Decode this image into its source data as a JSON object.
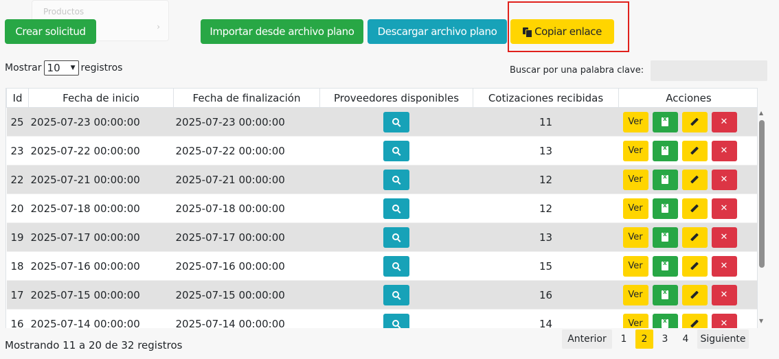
{
  "background_menu": {
    "item1": "Productos",
    "item2": "",
    "chevron": "›"
  },
  "toolbar": {
    "crear": "Crear solicitud",
    "importar": "Importar desde archivo plano",
    "descargar": "Descargar archivo plano",
    "copiar": "Copiar enlace",
    "copiar_icon": "copy-icon"
  },
  "colors": {
    "green": "#28a745",
    "teal": "#17a2b8",
    "yellow": "#ffd500",
    "red": "#dc3545",
    "highlight": "#e0201b"
  },
  "controls": {
    "mostrar": "Mostrar",
    "page_size": "10",
    "registros": "registros",
    "buscar_label": "Buscar por una palabra clave:",
    "buscar_value": ""
  },
  "table": {
    "headers": [
      "Id",
      "Fecha de inicio",
      "Fecha de finalización",
      "Proveedores disponibles",
      "Cotizaciones recibidas",
      "Acciones"
    ],
    "ver_label": "Ver",
    "rows": [
      {
        "id": "25",
        "inicio": "2025-07-23 00:00:00",
        "fin": "2025-07-23 00:00:00",
        "cotizaciones": "11"
      },
      {
        "id": "23",
        "inicio": "2025-07-22 00:00:00",
        "fin": "2025-07-22 00:00:00",
        "cotizaciones": "13"
      },
      {
        "id": "22",
        "inicio": "2025-07-21 00:00:00",
        "fin": "2025-07-21 00:00:00",
        "cotizaciones": "12"
      },
      {
        "id": "20",
        "inicio": "2025-07-18 00:00:00",
        "fin": "2025-07-18 00:00:00",
        "cotizaciones": "12"
      },
      {
        "id": "19",
        "inicio": "2025-07-17 00:00:00",
        "fin": "2025-07-17 00:00:00",
        "cotizaciones": "13"
      },
      {
        "id": "18",
        "inicio": "2025-07-16 00:00:00",
        "fin": "2025-07-16 00:00:00",
        "cotizaciones": "15"
      },
      {
        "id": "17",
        "inicio": "2025-07-15 00:00:00",
        "fin": "2025-07-15 00:00:00",
        "cotizaciones": "16"
      },
      {
        "id": "16",
        "inicio": "2025-07-14 00:00:00",
        "fin": "2025-07-14 00:00:00",
        "cotizaciones": "14"
      }
    ]
  },
  "footer": {
    "info": "Mostrando 11 a 20 de 32 registros",
    "anterior": "Anterior",
    "pages": [
      "1",
      "2",
      "3",
      "4"
    ],
    "current_page": "2",
    "siguiente": "Siguiente"
  }
}
